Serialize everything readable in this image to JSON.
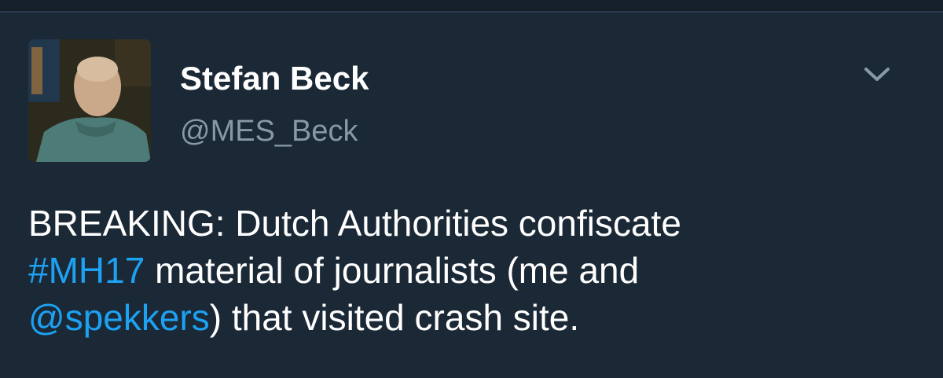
{
  "author": {
    "display_name": "Stefan Beck",
    "handle": "@MES_Beck"
  },
  "tweet": {
    "line1": "BREAKING: Dutch Authorities confiscate",
    "hashtag": "#MH17",
    "line2_rest": " material of journalists (me and",
    "mention": "@spekkers",
    "line3_rest": ") that visited crash site."
  },
  "icons": {
    "menu": "chevron-down-icon",
    "avatar": "profile-photo"
  },
  "colors": {
    "background": "#1b2836",
    "text": "#ffffff",
    "secondary_text": "#8899a6",
    "link": "#1da1f2"
  }
}
